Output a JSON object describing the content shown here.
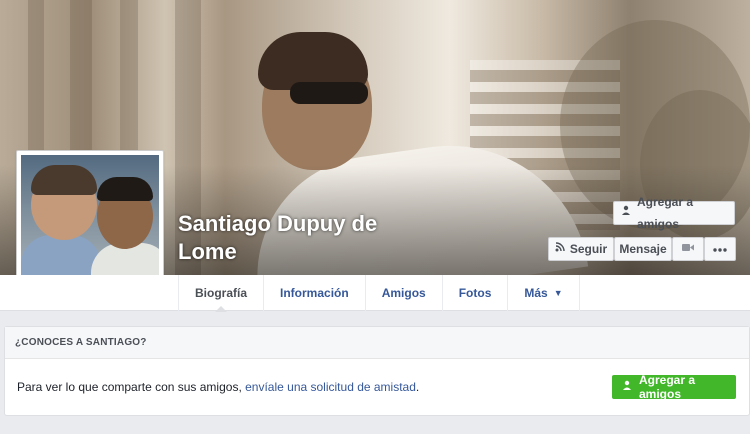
{
  "profile": {
    "name": "Santiago Dupuy de Lome"
  },
  "actions": {
    "add_friend_top": "Agregar a amigos",
    "follow": "Seguir",
    "message": "Mensaje",
    "video_icon": "video-camera-icon",
    "more_icon": "ellipsis-icon",
    "add_friend_icon": "add-person-icon",
    "follow_icon": "rss-icon"
  },
  "tabs": [
    {
      "label": "Biografía",
      "active": true
    },
    {
      "label": "Información",
      "active": false
    },
    {
      "label": "Amigos",
      "active": false
    },
    {
      "label": "Fotos",
      "active": false
    },
    {
      "label": "Más",
      "active": false
    }
  ],
  "know_card": {
    "header": "¿CONOCES A SANTIAGO?",
    "text_prefix": "Para ver lo que comparte con sus amigos, ",
    "link_text": "envíale una solicitud de amistad",
    "text_suffix": ".",
    "button": "Agregar a amigos"
  },
  "colors": {
    "link": "#365899",
    "green_button": "#42b72a",
    "page_bg": "#e9ebee"
  }
}
